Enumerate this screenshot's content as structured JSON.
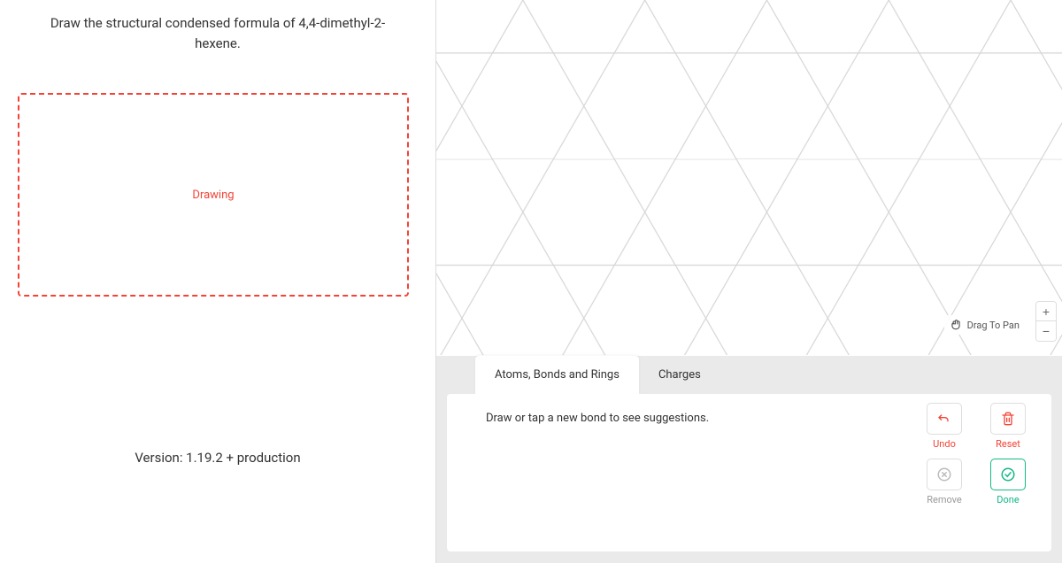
{
  "question": {
    "prompt": "Draw the structural condensed formula of 4,4-dimethyl-2-hexene."
  },
  "drawing_area": {
    "placeholder": "Drawing"
  },
  "footer": {
    "version": "Version: 1.19.2 +  production"
  },
  "canvas": {
    "pan_label": "Drag To Pan",
    "zoom_in": "+",
    "zoom_out": "−"
  },
  "toolbox": {
    "tabs": [
      {
        "label": "Atoms, Bonds and Rings",
        "active": true
      },
      {
        "label": "Charges",
        "active": false
      }
    ],
    "hint": "Draw or tap a new bond to see suggestions.",
    "actions": {
      "undo": "Undo",
      "reset": "Reset",
      "remove": "Remove",
      "done": "Done"
    }
  }
}
